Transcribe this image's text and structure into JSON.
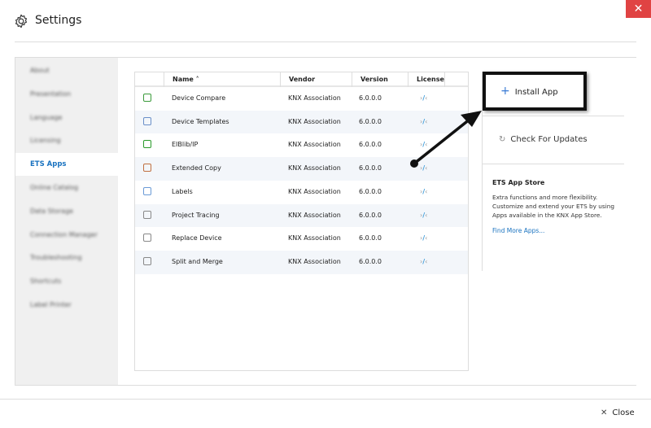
{
  "window": {
    "title": "Settings",
    "close_glyph": "✕"
  },
  "sidebar": {
    "items": [
      {
        "label": "About"
      },
      {
        "label": "Presentation"
      },
      {
        "label": "Language"
      },
      {
        "label": "Licensing"
      },
      {
        "label": "ETS Apps",
        "selected": true
      },
      {
        "label": "Online Catalog"
      },
      {
        "label": "Data Storage"
      },
      {
        "label": "Connection Manager"
      },
      {
        "label": "Troubleshooting"
      },
      {
        "label": "Shortcuts"
      },
      {
        "label": "Label Printer"
      }
    ]
  },
  "table": {
    "headers": {
      "name": "Name ˄",
      "vendor": "Vendor",
      "version": "Version",
      "license": "License"
    },
    "rows": [
      {
        "name": "Device Compare",
        "vendor": "KNX Association",
        "version": "6.0.0.0",
        "icon": "device-compare-icon"
      },
      {
        "name": "Device Templates",
        "vendor": "KNX Association",
        "version": "6.0.0.0",
        "icon": "device-templates-icon"
      },
      {
        "name": "EIBlib/IP",
        "vendor": "KNX Association",
        "version": "6.0.0.0",
        "icon": "network-icon"
      },
      {
        "name": "Extended Copy",
        "vendor": "KNX Association",
        "version": "6.0.0.0",
        "icon": "clipboard-icon"
      },
      {
        "name": "Labels",
        "vendor": "KNX Association",
        "version": "6.0.0.0",
        "icon": "tag-icon"
      },
      {
        "name": "Project Tracing",
        "vendor": "KNX Association",
        "version": "6.0.0.0",
        "icon": "document-icon"
      },
      {
        "name": "Replace Device",
        "vendor": "KNX Association",
        "version": "6.0.0.0",
        "icon": "replace-device-icon"
      },
      {
        "name": "Split and Merge",
        "vendor": "KNX Association",
        "version": "6.0.0.0",
        "icon": "split-merge-icon"
      }
    ]
  },
  "actions": {
    "install": "Install App",
    "updates": "Check For Updates"
  },
  "store": {
    "title": "ETS App Store",
    "description": "Extra functions and more flexibility. Customize and extend your ETS by using Apps available in the KNX App Store.",
    "link": "Find More Apps..."
  },
  "footer": {
    "close": "Close"
  }
}
